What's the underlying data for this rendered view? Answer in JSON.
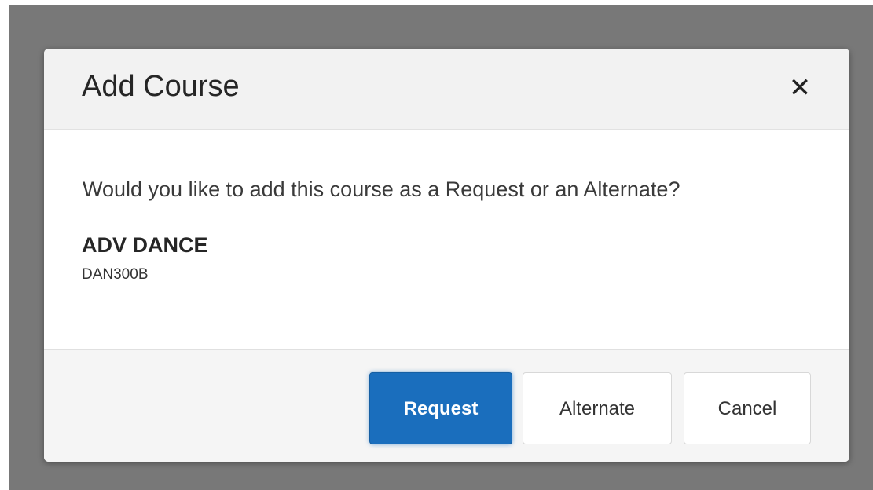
{
  "dialog": {
    "title": "Add Course",
    "close_icon": "close-icon",
    "close_glyph": "✕",
    "question": "Would you like to add this course as a Request or an Alternate?",
    "course": {
      "name": "ADV DANCE",
      "code": "DAN300B"
    },
    "buttons": {
      "request_label": "Request",
      "alternate_label": "Alternate",
      "cancel_label": "Cancel"
    }
  },
  "colors": {
    "backdrop": "#787878",
    "header_bg": "#f2f2f2",
    "footer_bg": "#f5f5f5",
    "primary_button": "#1a6ebd",
    "primary_button_text": "#ffffff"
  }
}
